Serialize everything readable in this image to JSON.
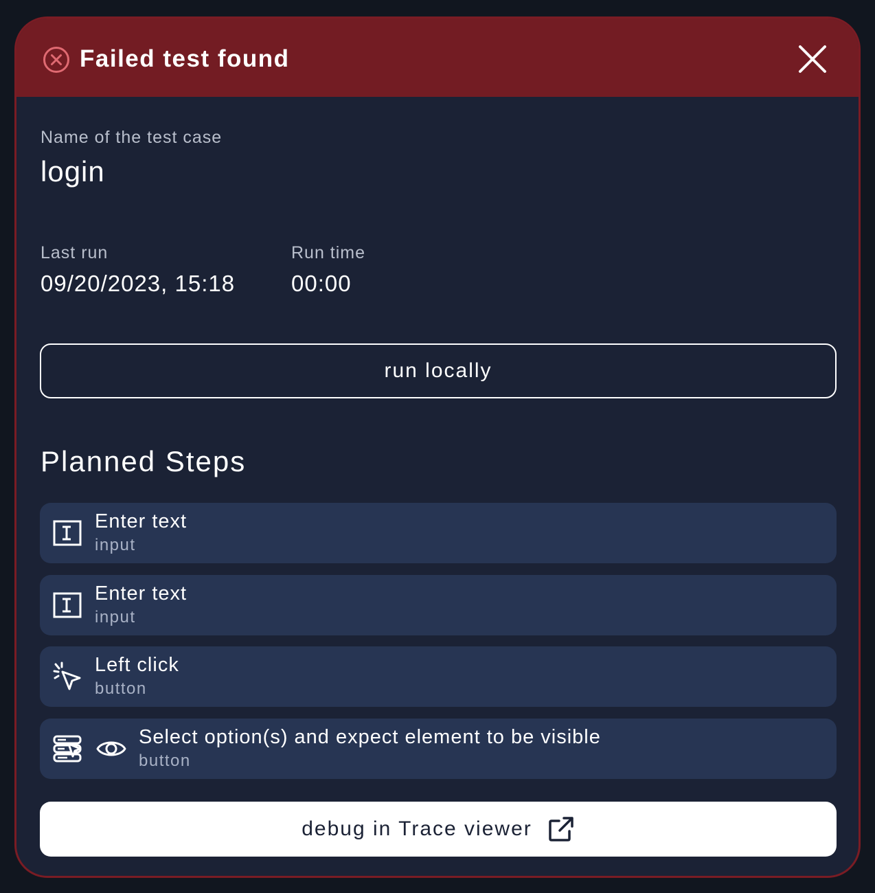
{
  "header": {
    "title": "Failed test found",
    "status_icon": "circle-x-icon",
    "close_icon": "close-icon"
  },
  "test_case": {
    "name_label": "Name of the test case",
    "name": "login"
  },
  "meta": {
    "last_run_label": "Last run",
    "last_run": "09/20/2023, 15:18",
    "run_time_label": "Run time",
    "run_time": "00:00"
  },
  "actions": {
    "run_locally": "run locally",
    "debug_trace": "debug in Trace viewer",
    "debug_icon": "external-link-icon"
  },
  "planned_steps": {
    "title": "Planned Steps",
    "items": [
      {
        "title": "Enter text",
        "subtitle": "input",
        "icons": [
          "text-input-icon"
        ]
      },
      {
        "title": "Enter text",
        "subtitle": "input",
        "icons": [
          "text-input-icon"
        ]
      },
      {
        "title": "Left click",
        "subtitle": "button",
        "icons": [
          "click-cursor-icon"
        ]
      },
      {
        "title": "Select option(s) and expect element to be visible",
        "subtitle": "button",
        "icons": [
          "select-option-icon",
          "eye-icon"
        ]
      }
    ]
  },
  "colors": {
    "header_bg": "#731c23",
    "border": "#7a1c24",
    "panel_bg": "#1b2235",
    "step_bg": "#273553",
    "status_icon": "#e06a72"
  }
}
